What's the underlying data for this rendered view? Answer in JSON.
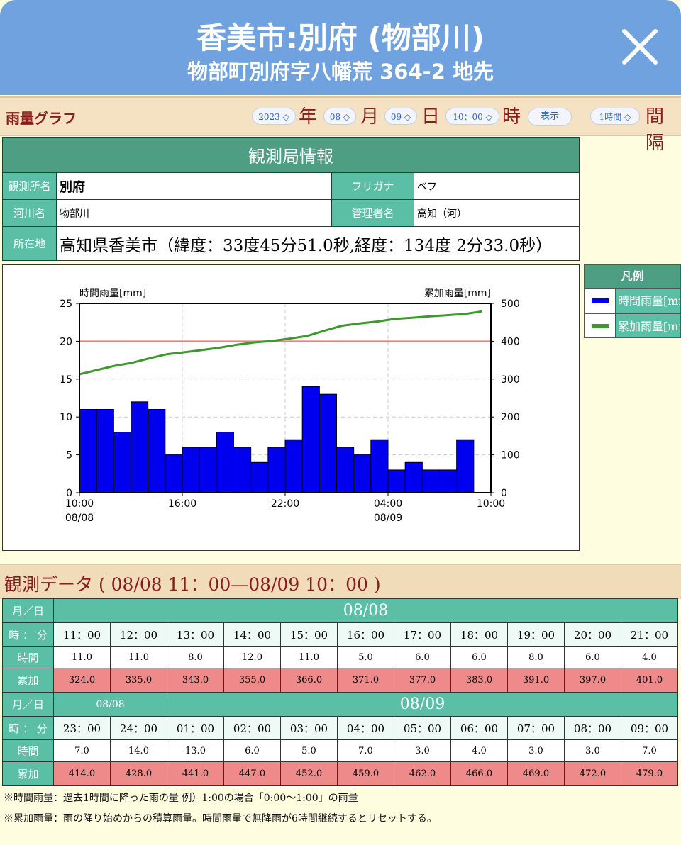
{
  "header": {
    "title": "香美市:別府 (物部川)",
    "address": "物部町別府字八幡荒 364-2 地先"
  },
  "toolbar": {
    "title": "雨量グラフ",
    "year_value": "2023",
    "year_unit": "年",
    "month_value": "08",
    "month_unit": "月",
    "day_value": "09",
    "day_unit": "日",
    "hour_value": "10：00",
    "hour_unit": "時",
    "show_button": "表示",
    "interval_value": "1時間",
    "interval_unit": "間隔"
  },
  "station": {
    "heading": "観測局情報",
    "name_label": "観測所名",
    "name_value": "別府",
    "kana_label": "フリガナ",
    "kana_value": "ベフ",
    "river_label": "河川名",
    "river_value": "物部川",
    "manager_label": "管理者名",
    "manager_value": "高知（河）",
    "location_label": "所在地",
    "location_value": "高知県香美市（緯度：33度45分51.0秒,経度：134度 2分33.0秒）"
  },
  "legend": {
    "heading": "凡例",
    "items": [
      {
        "label": "時間雨量[mm]",
        "color": "#0000ee"
      },
      {
        "label": "累加雨量[mm]",
        "color": "#3a9a2a"
      }
    ]
  },
  "chart_data": {
    "type": "bar",
    "left_axis_label": "時間雨量[mm]",
    "right_axis_label": "累加雨量[mm]",
    "ylim_left": [
      0,
      25
    ],
    "ylim_right": [
      0,
      500
    ],
    "left_ticks": [
      "0",
      "5",
      "10",
      "15",
      "20",
      "25"
    ],
    "right_ticks": [
      "0",
      "100",
      "200",
      "300",
      "400",
      "500"
    ],
    "x_ticks": [
      {
        "time": "10:00",
        "date": "08/08"
      },
      {
        "time": "16:00",
        "date": ""
      },
      {
        "time": "22:00",
        "date": ""
      },
      {
        "time": "04:00",
        "date": "08/09"
      },
      {
        "time": "10:00",
        "date": ""
      }
    ],
    "threshold": 20,
    "bar_color": "#0000ee",
    "line_color": "#3a9a2a",
    "threshold_color": "#f08080",
    "hourly_rain": [
      11,
      11,
      8,
      12,
      11,
      5,
      6,
      6,
      8,
      6,
      4,
      6,
      7,
      14,
      13,
      6,
      5,
      7,
      3,
      4,
      3,
      3,
      7
    ],
    "cumulative_rain": [
      313,
      324,
      335,
      343,
      355,
      366,
      371,
      377,
      383,
      391,
      397,
      401,
      407,
      414,
      428,
      441,
      447,
      452,
      459,
      462,
      466,
      469,
      472,
      479
    ]
  },
  "observations": {
    "title": "観測データ ( 08/08 11：00—08/09 10：00 )",
    "date_label": "月／日",
    "time_label": "時 ： 分",
    "hourly_label": "時間",
    "cumulative_label": "累加",
    "block1": {
      "date": "08/08",
      "times": [
        "11：00",
        "12：00",
        "13：00",
        "14：00",
        "15：00",
        "16：00",
        "17：00",
        "18：00",
        "19：00",
        "20：00",
        "21：00"
      ],
      "hourly": [
        "11.0",
        "11.0",
        "8.0",
        "12.0",
        "11.0",
        "5.0",
        "6.0",
        "6.0",
        "8.0",
        "6.0",
        "4.0"
      ],
      "cumulative": [
        "324.0",
        "335.0",
        "343.0",
        "355.0",
        "366.0",
        "371.0",
        "377.0",
        "383.0",
        "391.0",
        "397.0",
        "401.0"
      ]
    },
    "block2": {
      "date_first": "08/08",
      "date_rest": "08/09",
      "times": [
        "23：00",
        "24：00",
        "01：00",
        "02：00",
        "03：00",
        "04：00",
        "05：00",
        "06：00",
        "07：00",
        "08：00",
        "09：00"
      ],
      "hourly": [
        "7.0",
        "14.0",
        "13.0",
        "6.0",
        "5.0",
        "7.0",
        "3.0",
        "4.0",
        "3.0",
        "3.0",
        "7.0"
      ],
      "cumulative": [
        "414.0",
        "428.0",
        "441.0",
        "447.0",
        "452.0",
        "459.0",
        "462.0",
        "466.0",
        "469.0",
        "472.0",
        "479.0"
      ]
    }
  },
  "notes": [
    "※時間雨量：過去1時間に降った雨の量 例）1:00の場合「0:00～1:00」の雨量",
    "※累加雨量：雨の降り始めからの積算雨量。時間雨量で無降雨が6時間継続するとリセットする。"
  ]
}
